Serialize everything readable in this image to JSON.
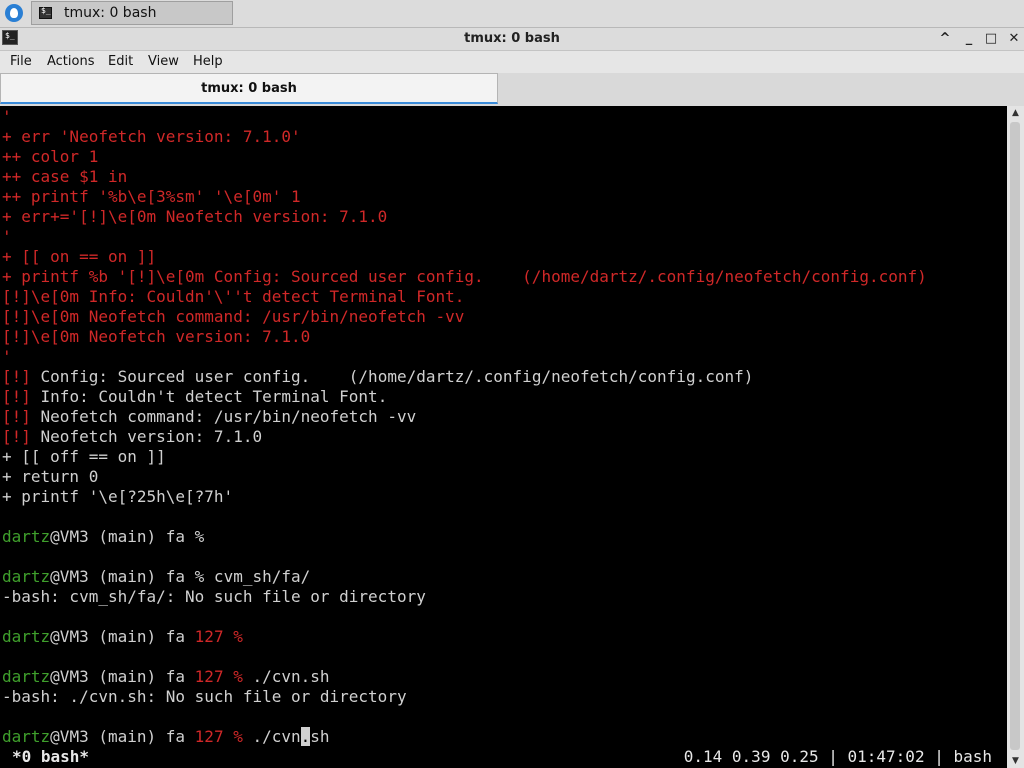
{
  "panel": {
    "task_label": "tmux: 0 bash"
  },
  "window": {
    "title": "tmux: 0 bash",
    "buttons": {
      "up": "^",
      "minimize": "_",
      "maximize": "□",
      "close": "✕"
    }
  },
  "menu": [
    "File",
    "Actions",
    "Edit",
    "View",
    "Help"
  ],
  "tab": {
    "label": "tmux: 0 bash"
  },
  "terminal": {
    "lines": [
      [
        {
          "t": "'",
          "c": "red"
        }
      ],
      [
        {
          "t": "+ err 'Neofetch version: 7.1.0'",
          "c": "red"
        }
      ],
      [
        {
          "t": "++ color 1",
          "c": "red"
        }
      ],
      [
        {
          "t": "++ case $1 in",
          "c": "red"
        }
      ],
      [
        {
          "t": "++ printf '%b\\e[3%sm' '\\e[0m' 1",
          "c": "red"
        }
      ],
      [
        {
          "t": "+ err+='[!]\\e[0m Neofetch version: 7.1.0",
          "c": "red"
        }
      ],
      [
        {
          "t": "'",
          "c": "red"
        }
      ],
      [
        {
          "t": "+ [[ on == on ]]",
          "c": "red"
        }
      ],
      [
        {
          "t": "+ printf %b '[!]\\e[0m Config: Sourced user config.    (/home/dartz/.config/neofetch/config.conf)",
          "c": "red"
        }
      ],
      [
        {
          "t": "[!]\\e[0m Info: Couldn'\\''t detect Terminal Font.",
          "c": "red"
        }
      ],
      [
        {
          "t": "[!]\\e[0m Neofetch command: /usr/bin/neofetch -vv",
          "c": "red"
        }
      ],
      [
        {
          "t": "[!]\\e[0m Neofetch version: 7.1.0",
          "c": "red"
        }
      ],
      [
        {
          "t": "'",
          "c": "red"
        }
      ],
      [
        {
          "t": "[!]",
          "c": "red"
        },
        {
          "t": " Config: Sourced user config.    (/home/dartz/.config/neofetch/config.conf)",
          "c": "gray"
        }
      ],
      [
        {
          "t": "[!]",
          "c": "red"
        },
        {
          "t": " Info: Couldn't detect Terminal Font.",
          "c": "gray"
        }
      ],
      [
        {
          "t": "[!]",
          "c": "red"
        },
        {
          "t": " Neofetch command: /usr/bin/neofetch -vv",
          "c": "gray"
        }
      ],
      [
        {
          "t": "[!]",
          "c": "red"
        },
        {
          "t": " Neofetch version: 7.1.0",
          "c": "gray"
        }
      ],
      [
        {
          "t": "+ [[ off == on ]]",
          "c": "gray"
        }
      ],
      [
        {
          "t": "+ return 0",
          "c": "gray"
        }
      ],
      [
        {
          "t": "+ printf '\\e[?25h\\e[?7h'",
          "c": "gray"
        }
      ],
      [],
      [
        {
          "t": "dartz",
          "c": "green"
        },
        {
          "t": "@VM3 (main) fa %",
          "c": "gray"
        }
      ],
      [],
      [
        {
          "t": "dartz",
          "c": "green"
        },
        {
          "t": "@VM3 (main) fa % cvm_sh/fa/",
          "c": "gray"
        }
      ],
      [
        {
          "t": "-bash: cvm_sh/fa/: No such file or directory",
          "c": "gray"
        }
      ],
      [],
      [
        {
          "t": "dartz",
          "c": "green"
        },
        {
          "t": "@VM3 (main) fa ",
          "c": "gray"
        },
        {
          "t": "127 %",
          "c": "red"
        }
      ],
      [],
      [
        {
          "t": "dartz",
          "c": "green"
        },
        {
          "t": "@VM3 (main) fa ",
          "c": "gray"
        },
        {
          "t": "127 %",
          "c": "red"
        },
        {
          "t": " ./cvn.sh",
          "c": "gray"
        }
      ],
      [
        {
          "t": "-bash: ./cvn.sh: No such file or directory",
          "c": "gray"
        }
      ],
      [],
      [
        {
          "t": "dartz",
          "c": "green"
        },
        {
          "t": "@VM3 (main) fa ",
          "c": "gray"
        },
        {
          "t": "127 %",
          "c": "red"
        },
        {
          "t": " ./cvn",
          "c": "gray"
        },
        {
          "t": ".",
          "c": "cursor"
        },
        {
          "t": "sh",
          "c": "gray"
        }
      ]
    ],
    "status_left": "*0 bash*",
    "status_right": "0.14 0.39 0.25 | 01:47:02 | bash"
  }
}
